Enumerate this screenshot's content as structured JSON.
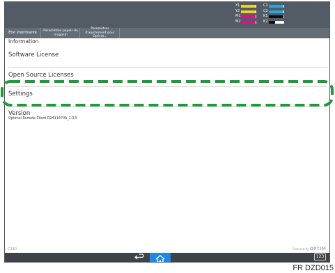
{
  "toner": [
    {
      "key": "Y1",
      "color": "#f2d21e",
      "fill": 0.95
    },
    {
      "key": "C1",
      "color": "#23a9e1",
      "fill": 0.95
    },
    {
      "key": "Y2",
      "color": "#f2d21e",
      "fill": 0.95
    },
    {
      "key": "C2",
      "color": "#23a9e1",
      "fill": 0.95
    },
    {
      "key": "M1",
      "color": "#d2177f",
      "fill": 0.95
    },
    {
      "key": "K1",
      "color": "#111111",
      "fill": 0.95
    },
    {
      "key": "M2",
      "color": "#d2177f",
      "fill": 0.95
    },
    {
      "key": "K2",
      "color": "#111111",
      "fill": 0.4
    }
  ],
  "tabs": {
    "status": "État imprimante",
    "paper": "Paramètres papier du magasin",
    "adjust": "Paramètres d'ajustement pour Opérat..."
  },
  "menu": {
    "information": "Information",
    "software_license": "Software License",
    "open_source": "Open Source Licenses",
    "settings": "Settings"
  },
  "version": {
    "title": "Version",
    "value": "Optimal Remote Client D2411470A_1.0.5"
  },
  "footer": {
    "model": "C110",
    "powered_prefix": "Powered by",
    "powered_brand": "OPTIM"
  },
  "bottombar": {
    "back_icon": "back-arrow-icon",
    "home_icon": "home-icon",
    "counter_label": "123"
  },
  "annotation": {
    "highlight_color": "#1e9a3c",
    "caption": "FR DZD015"
  }
}
